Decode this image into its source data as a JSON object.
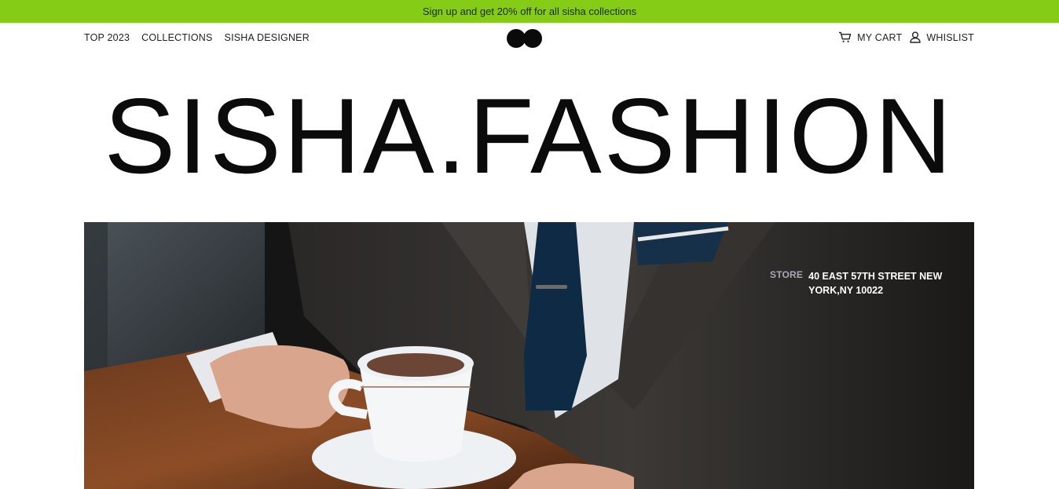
{
  "promo": {
    "text": "Sign up and get 20% off for all sisha collections"
  },
  "nav": {
    "links": [
      {
        "label": "TOP 2023"
      },
      {
        "label": "COLLECTIONS"
      },
      {
        "label": "SISHA DESIGNER"
      }
    ],
    "cart": {
      "label": "MY CART",
      "icon": "cart-icon"
    },
    "wishlist": {
      "label": "WHISLIST",
      "icon": "user-icon"
    }
  },
  "brand": {
    "title": "SISHA.FASHION"
  },
  "hero": {
    "store_label": "STORE",
    "store_address": "40 EAST 57TH STREET NEW YORK,NY 10022"
  },
  "colors": {
    "promo_background": "#84cc16",
    "title": "#0b0b0b",
    "hero_background": "#1b1b1b"
  }
}
